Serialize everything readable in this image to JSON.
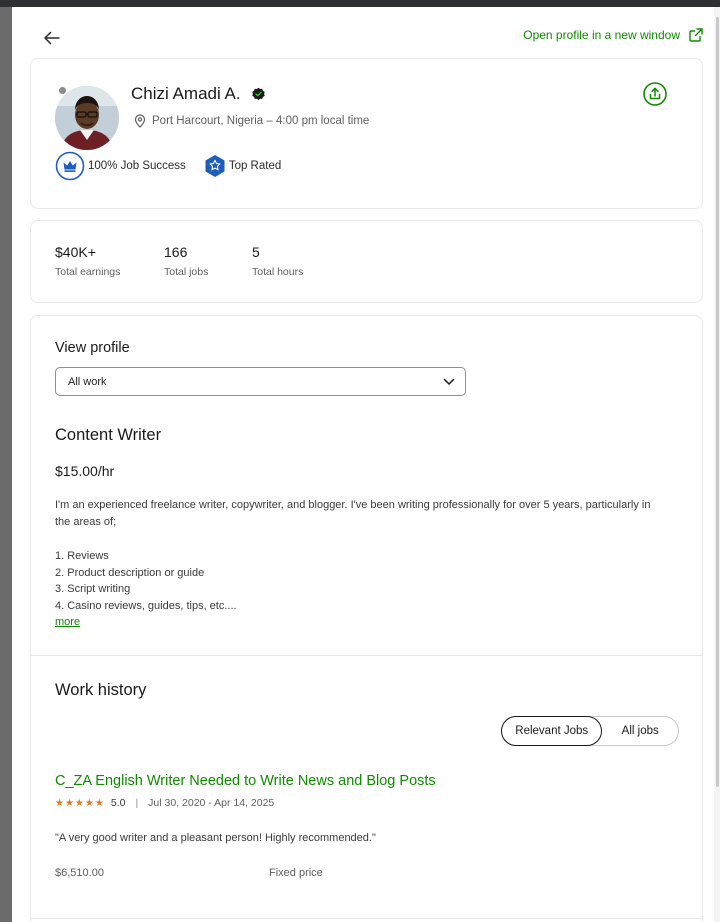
{
  "header": {
    "back_icon": "arrow-left-icon",
    "open_new_window_label": "Open profile in a new window",
    "open_icon": "external-link-icon",
    "accent": "#108a00"
  },
  "profile": {
    "name": "Chizi Amadi A.",
    "verified_icon": "verified-check-icon",
    "location": "Port Harcourt, Nigeria – 4:00 pm local time",
    "location_icon": "map-pin-icon",
    "badges": [
      {
        "label": "100% Job Success",
        "icon": "crown-icon"
      },
      {
        "label": "Top Rated",
        "icon": "star-badge-icon"
      }
    ],
    "share_icon": "share-icon",
    "online_status": "offline"
  },
  "stats": [
    {
      "value": "$40K+",
      "label": "Total earnings"
    },
    {
      "value": "166",
      "label": "Total jobs"
    },
    {
      "value": "5",
      "label": "Total hours"
    }
  ],
  "main": {
    "view_profile_label": "View profile",
    "select_value": "All work",
    "job_title": "Content Writer",
    "rate": "$15.00/hr",
    "description": "I'm an experienced freelance writer, copywriter, and blogger. I've been writing professionally for over 5 years, particularly in the areas of;",
    "list": [
      "1. Reviews",
      "2. Product description or guide",
      "3. Script writing",
      "4. Casino reviews, guides, tips, etc...."
    ],
    "more_label": "more"
  },
  "work_history": {
    "title": "Work history",
    "tabs": [
      {
        "label": "Relevant Jobs",
        "active": true
      },
      {
        "label": "All jobs",
        "active": false
      }
    ],
    "items": [
      {
        "title": "C_ZA English Writer Needed to Write News and Blog Posts",
        "stars": "★★★★★",
        "rating": "5.0",
        "separator": "|",
        "dates": "Jul 30, 2020 - Apr 14, 2025",
        "feedback": "\"A very good writer and a pleasant person! Highly recommended.\"",
        "amount": "$6,510.00",
        "price_type": "Fixed price"
      }
    ]
  }
}
